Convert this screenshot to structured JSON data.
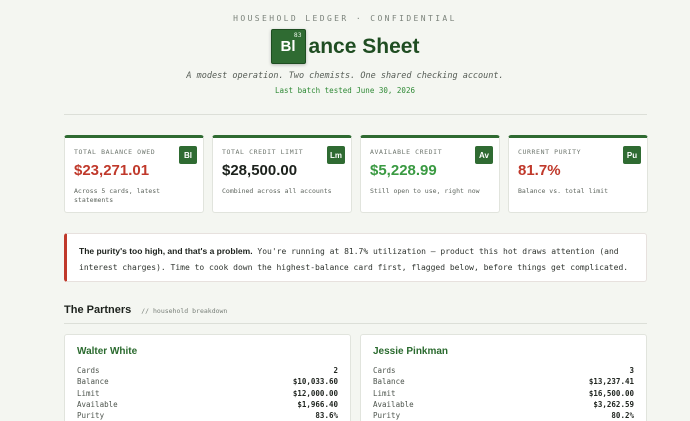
{
  "header": {
    "kicker": "HOUSEHOLD LEDGER · CONFIDENTIAL",
    "tile_symbol": "Bl",
    "tile_number": "83",
    "title_rest": "ance Sheet",
    "subtitle": "A modest operation. Two chemists. One shared checking account.",
    "tested": "Last batch tested June 30, 2026"
  },
  "colors": {
    "brand_green": "#2f6b32",
    "red": "#c0392b",
    "bright_green": "#3a9a42"
  },
  "stats": [
    {
      "label": "TOTAL BALANCE OWED",
      "value": "$23,271.01",
      "note": "Across 5 cards, latest statements",
      "badge": "Bl",
      "color": "#c0392b"
    },
    {
      "label": "TOTAL CREDIT LIMIT",
      "value": "$28,500.00",
      "note": "Combined across all accounts",
      "badge": "Lm",
      "color": "#1c211c"
    },
    {
      "label": "AVAILABLE CREDIT",
      "value": "$5,228.99",
      "note": "Still open to use, right now",
      "badge": "Av",
      "color": "#3a9a42"
    },
    {
      "label": "CURRENT PURITY",
      "value": "81.7%",
      "note": "Balance vs. total limit",
      "badge": "Pu",
      "color": "#c0392b"
    }
  ],
  "alert": {
    "bold": "The purity's too high, and that's a problem.",
    "text": " You're running at 81.7% utilization — product this hot draws attention (and interest charges). Time to cook down the highest-balance card first, flagged below, before things get complicated."
  },
  "partners_section": {
    "title": "The Partners",
    "subtitle": "// household breakdown"
  },
  "partners": [
    {
      "name": "Walter White",
      "rows": [
        {
          "k": "Cards",
          "v": "2"
        },
        {
          "k": "Balance",
          "v": "$10,033.60"
        },
        {
          "k": "Limit",
          "v": "$12,000.00"
        },
        {
          "k": "Available",
          "v": "$1,966.40"
        },
        {
          "k": "Purity",
          "v": "83.6%"
        }
      ]
    },
    {
      "name": "Jessie Pinkman",
      "rows": [
        {
          "k": "Cards",
          "v": "3"
        },
        {
          "k": "Balance",
          "v": "$13,237.41"
        },
        {
          "k": "Limit",
          "v": "$16,500.00"
        },
        {
          "k": "Available",
          "v": "$3,262.59"
        },
        {
          "k": "Purity",
          "v": "80.2%"
        }
      ]
    }
  ]
}
